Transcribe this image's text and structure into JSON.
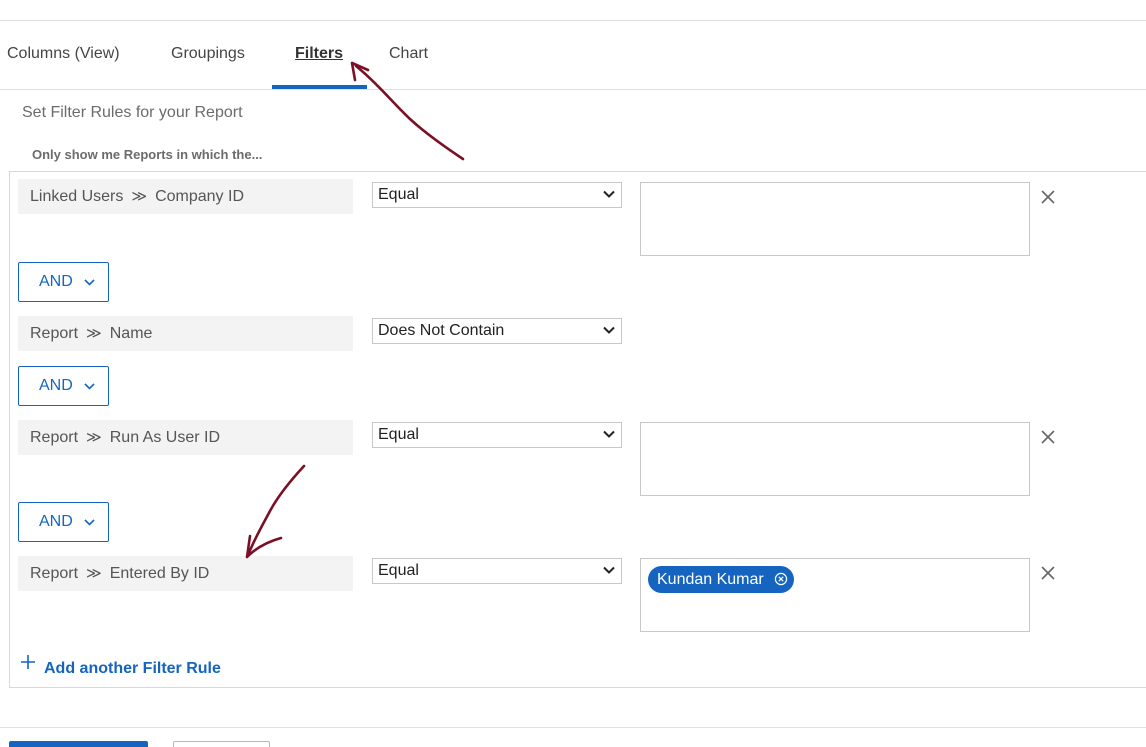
{
  "tabs": [
    {
      "label": "Columns (View)"
    },
    {
      "label": "Groupings"
    },
    {
      "label": "Filters",
      "active": true
    },
    {
      "label": "Chart"
    }
  ],
  "filters_section": {
    "title": "Set Filter Rules for your Report",
    "subtitle": "Only show me Reports in which the..."
  },
  "rules": [
    {
      "object": "Linked Users",
      "field": "Company ID",
      "operator": "Equal",
      "value": ""
    },
    {
      "connector": "AND"
    },
    {
      "object": "Report",
      "field": "Name",
      "operator": "Does Not Contain"
    },
    {
      "connector": "AND"
    },
    {
      "object": "Report",
      "field": "Run As User ID",
      "operator": "Equal",
      "value": ""
    },
    {
      "connector": "AND"
    },
    {
      "object": "Report",
      "field": "Entered By ID",
      "operator": "Equal",
      "chip": "Kundan Kumar"
    }
  ],
  "separator_glyph": "≫",
  "add_rule_label": "Add another Filter Rule",
  "colors": {
    "accent": "#1565c0",
    "annotation": "#7a0f25",
    "field_bg": "#f3f3f3"
  },
  "icons": [
    "chevron-down-icon",
    "close-icon",
    "chip-remove-icon",
    "plus-icon"
  ]
}
